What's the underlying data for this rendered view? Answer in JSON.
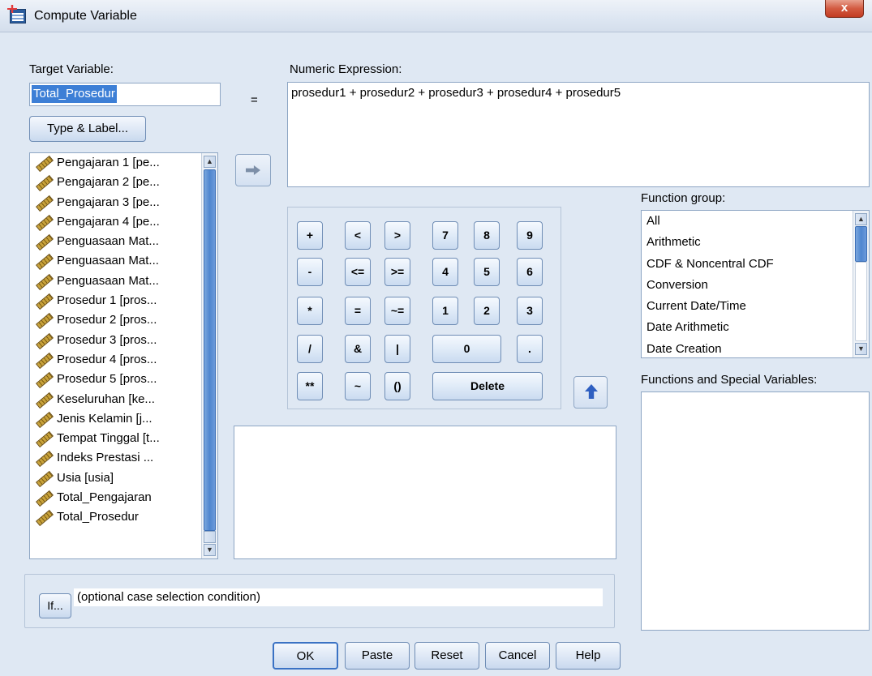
{
  "window": {
    "title": "Compute Variable",
    "close_label": "x"
  },
  "target": {
    "label_pre": "T",
    "label_u": "",
    "label": "Target Variable:",
    "value": "Total_Prosedur"
  },
  "equals": "=",
  "type_label_btn": "Type & Label...",
  "expression": {
    "label": "Numeric Expression:",
    "value": "prosedur1 + prosedur2 + prosedur3 + prosedur4 + prosedur5"
  },
  "variables": [
    "Pengajaran 1 [pe...",
    "Pengajaran 2 [pe...",
    "Pengajaran 3 [pe...",
    "Pengajaran 4 [pe...",
    "Penguasaan Mat...",
    "Penguasaan Mat...",
    "Penguasaan Mat...",
    "Prosedur 1 [pros...",
    "Prosedur 2 [pros...",
    "Prosedur 3 [pros...",
    "Prosedur 4 [pros...",
    "Prosedur 5 [pros...",
    "Keseluruhan [ke...",
    "Jenis Kelamin  [j...",
    "Tempat Tinggal [t...",
    "Indeks Prestasi ...",
    "Usia [usia]",
    "Total_Pengajaran",
    "Total_Prosedur"
  ],
  "keypad": {
    "row1": [
      "+",
      "<",
      ">",
      "7",
      "8",
      "9"
    ],
    "row2": [
      "-",
      "<=",
      ">=",
      "4",
      "5",
      "6"
    ],
    "row3": [
      "*",
      "=",
      "~=",
      "1",
      "2",
      "3"
    ],
    "row4": [
      "/",
      "&",
      "|",
      "0",
      "."
    ],
    "row5": [
      "**",
      "~",
      "()",
      "Delete"
    ]
  },
  "function_group": {
    "label": "Function group:",
    "items": [
      "All",
      "Arithmetic",
      "CDF & Noncentral CDF",
      "Conversion",
      "Current Date/Time",
      "Date Arithmetic",
      "Date Creation"
    ]
  },
  "functions_label": "Functions and Special Variables:",
  "if_section": {
    "button": "If...",
    "text": "(optional case selection condition)"
  },
  "buttons": {
    "ok": "OK",
    "paste": "Paste",
    "reset": "Reset",
    "cancel": "Cancel",
    "help": "Help"
  },
  "colors": {
    "background": "#dfe8f3",
    "selection": "#3d7fd6",
    "accent_arrow": "#2f5fc1"
  }
}
